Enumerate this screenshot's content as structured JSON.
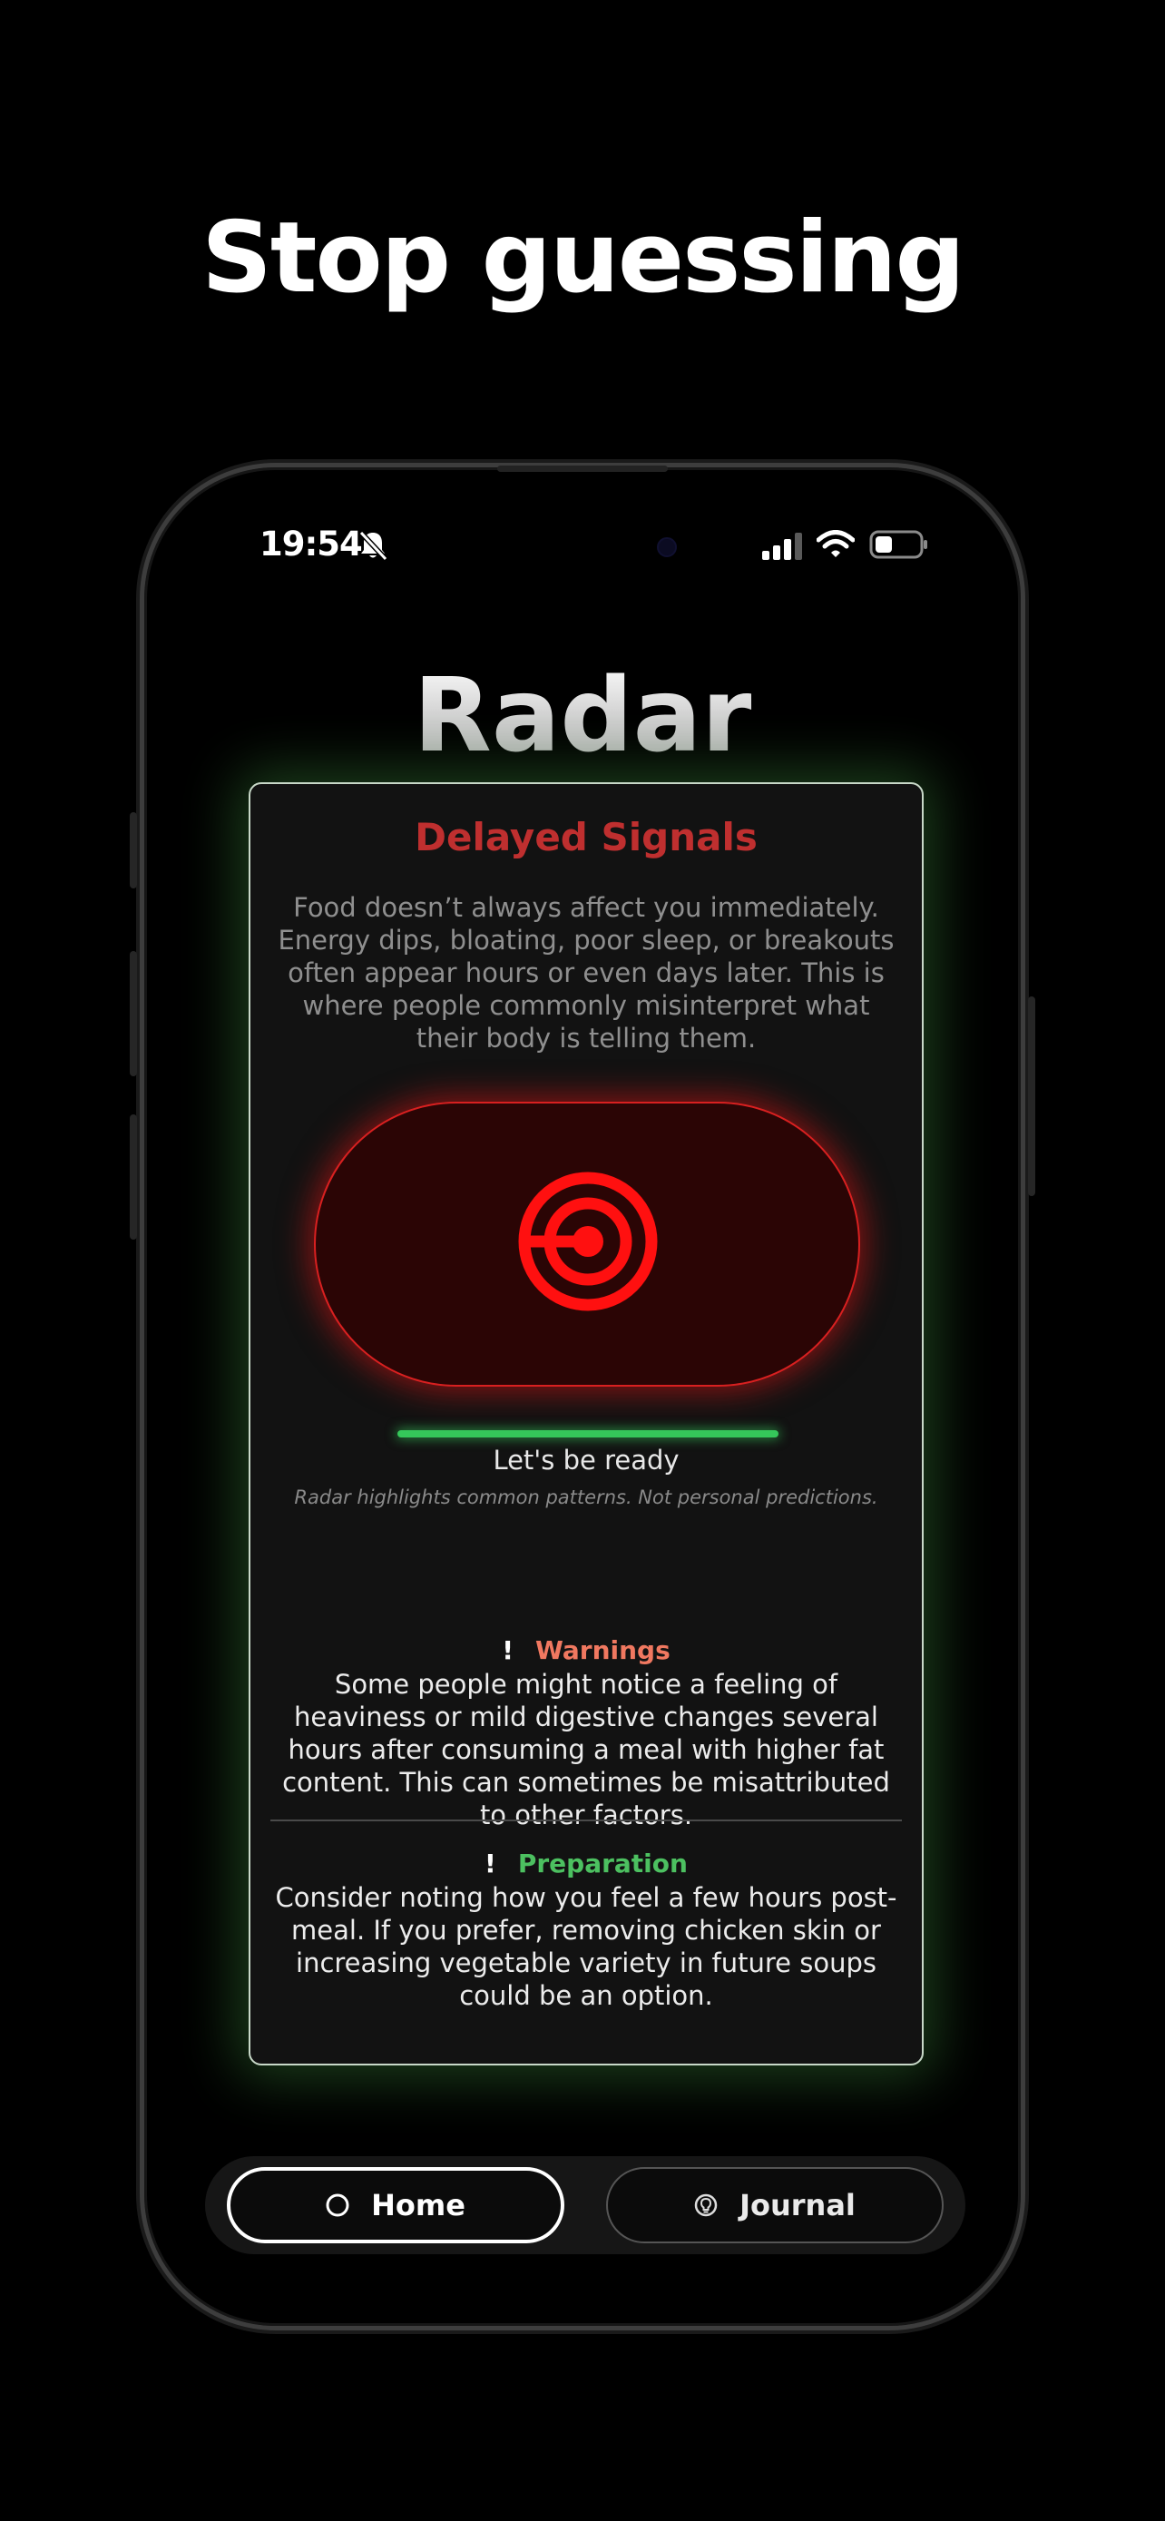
{
  "headline": "Stop guessing",
  "status_bar": {
    "time": "19:54",
    "icons": [
      "bell-slash-icon",
      "cellular-signal-icon",
      "wifi-icon",
      "battery-icon"
    ]
  },
  "app": {
    "title": "Radar",
    "card": {
      "title": "Delayed Signals",
      "description": "Food doesn’t always affect you immediately. Energy dips, bloating, poor sleep, or breakouts often appear hours or even days later. This is where people commonly misinterpret what their body is telling them.",
      "radar_icon": "target-icon",
      "progress": 1.0,
      "ready_label": "Let's be ready",
      "disclaimer": "Radar highlights common patterns. Not personal predictions.",
      "warnings": {
        "marker": "!",
        "title": "Warnings",
        "body": "Some people might notice a feeling of heaviness or mild digestive changes several hours after consuming a meal with higher fat content. This can sometimes be misattributed to other factors."
      },
      "preparation": {
        "marker": "!",
        "title": "Preparation",
        "body": "Consider noting how you feel a few hours post-meal. If you prefer, removing chicken skin or increasing vegetable variety in future soups could be an option."
      }
    },
    "tabs": [
      {
        "label": "Home",
        "icon": "circle-icon",
        "active": true
      },
      {
        "label": "Journal",
        "icon": "lightbulb-icon",
        "active": false
      }
    ]
  },
  "colors": {
    "card_title": "#bf2f2f",
    "radar_red": "#ff1a1a",
    "progress": "#35c75a",
    "warnings": "#f07860",
    "preparation": "#4cc060",
    "card_glow": "#48a048"
  }
}
